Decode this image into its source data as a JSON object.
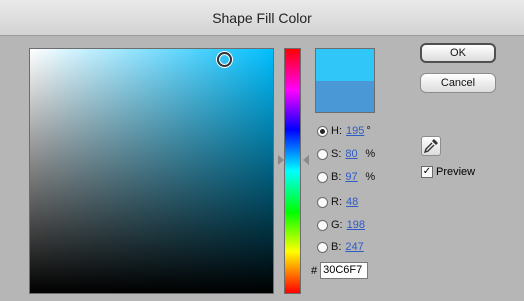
{
  "window": {
    "title": "Shape Fill Color"
  },
  "colors": {
    "new": "#30C6F7",
    "current": "#4A98D6",
    "field_hue": "#00BFFF"
  },
  "fields": [
    {
      "name": "h",
      "label": "H:",
      "value": "195",
      "unit": "°",
      "selected": true
    },
    {
      "name": "s",
      "label": "S:",
      "value": "80",
      "unit": "%",
      "selected": false
    },
    {
      "name": "b",
      "label": "B:",
      "value": "97",
      "unit": "%",
      "selected": false
    },
    {
      "name": "r",
      "label": "R:",
      "value": "48",
      "unit": "",
      "selected": false
    },
    {
      "name": "g",
      "label": "G:",
      "value": "198",
      "unit": "",
      "selected": false
    },
    {
      "name": "b2",
      "label": "B:",
      "value": "247",
      "unit": "",
      "selected": false
    }
  ],
  "hex": {
    "label": "#",
    "value": "30C6F7"
  },
  "buttons": {
    "ok": "OK",
    "cancel": "Cancel"
  },
  "preview": {
    "label": "Preview",
    "checked": true,
    "check_glyph": "✓"
  },
  "icons": {
    "eyedropper": "eyedropper-icon"
  }
}
